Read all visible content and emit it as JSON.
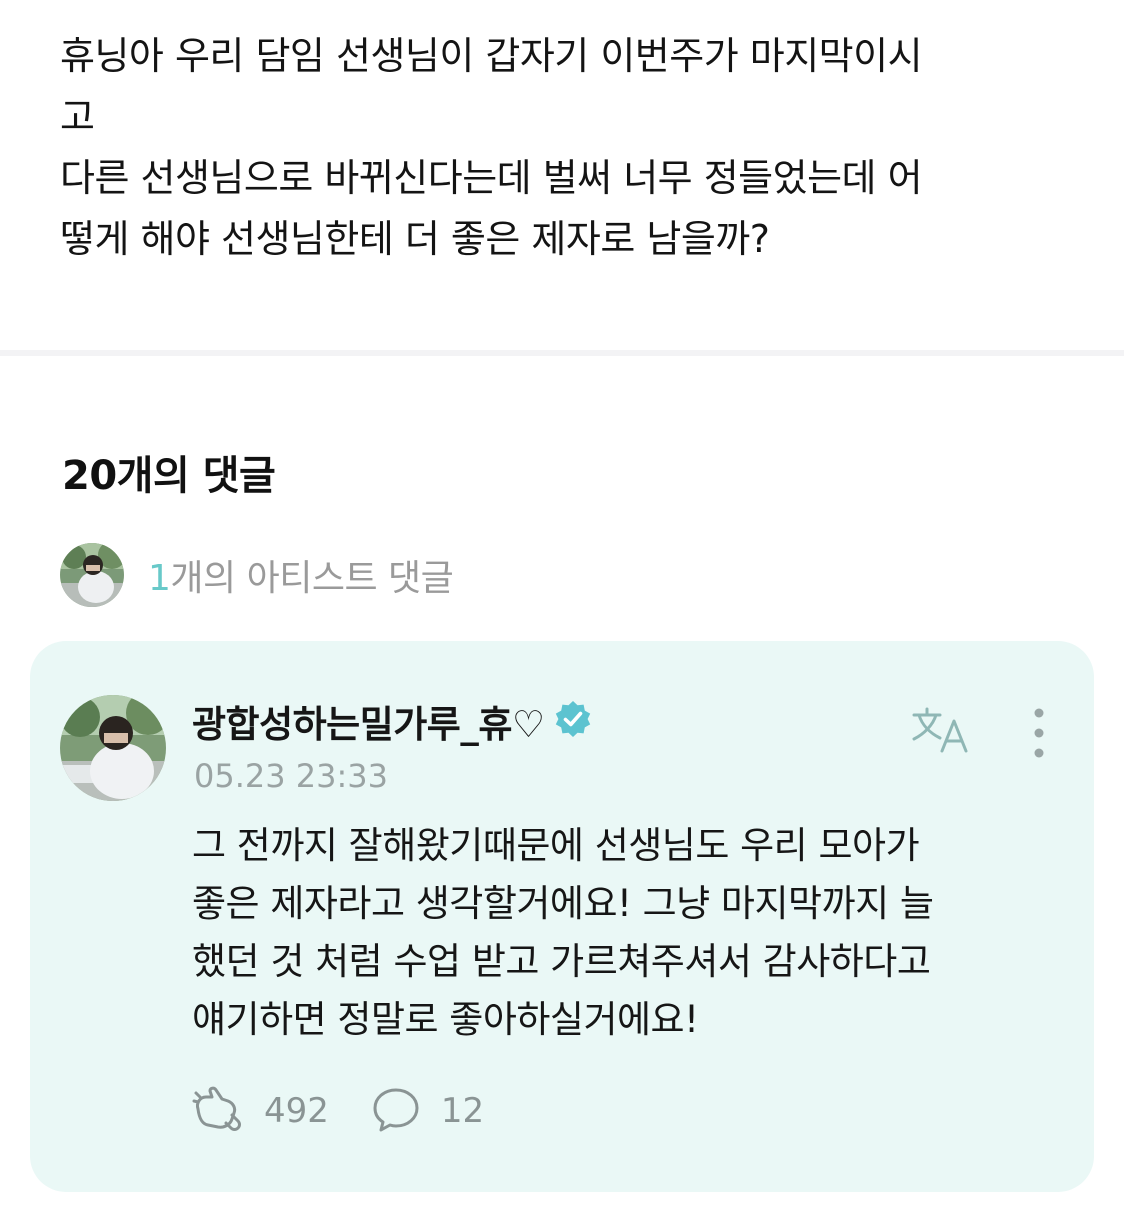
{
  "post": {
    "lines": [
      "휴닝아 우리 담임 선생님이 갑자기 이번주가 마지막이시",
      "고",
      "다른 선생님으로 바뀌신다는데 벌써 너무 정들었는데 어",
      "떻게 해야 선생님한테 더 좋은 제자로 남을까?"
    ]
  },
  "comments_header": {
    "title": "20개의 댓글"
  },
  "artist_summary": {
    "count": "1",
    "label": "개의 아티스트 댓글"
  },
  "comment": {
    "author": "광합성하는밀가루_휴♡",
    "timestamp": "05.23 23:33",
    "lines": [
      "그 전까지 잘해왔기때문에 선생님도 우리 모아가",
      "좋은 제자라고 생각할거에요! 그냥 마지막까지 늘",
      "했던 것 처럼 수업 받고 가르쳐주셔서 감사하다고",
      "얘기하면 정말로 좋아하실거에요!"
    ],
    "likes": "492",
    "replies": "12"
  },
  "icons": {
    "verified": "verified-check-icon",
    "translate": "translate-icon",
    "more": "more-vertical-icon",
    "like": "like-hand-icon",
    "reply": "reply-bubble-icon"
  },
  "colors": {
    "card_background": "#eaf8f6",
    "accent": "#68c9c9",
    "verified": "#5cc3d0",
    "muted_text": "#9a9a9a"
  }
}
